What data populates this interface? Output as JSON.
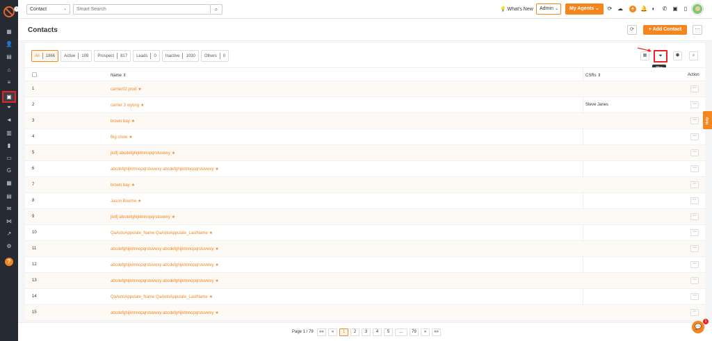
{
  "sidebar": {
    "items": [
      {
        "icon": "grid-icon",
        "glyph": "▦"
      },
      {
        "icon": "user-icon",
        "glyph": "👤"
      },
      {
        "icon": "document-icon",
        "glyph": "▤"
      },
      {
        "icon": "bank-icon",
        "glyph": "⌂"
      },
      {
        "icon": "list-icon",
        "glyph": "≡"
      },
      {
        "icon": "contacts-icon",
        "glyph": "▣",
        "active": true
      },
      {
        "icon": "funnel-icon",
        "glyph": "⏷"
      },
      {
        "icon": "megaphone-icon",
        "glyph": "◄"
      },
      {
        "icon": "file-icon",
        "glyph": "▥"
      },
      {
        "icon": "bar-chart-icon",
        "glyph": "▮"
      },
      {
        "icon": "folder-icon",
        "glyph": "▭"
      },
      {
        "icon": "google-icon",
        "glyph": "G"
      },
      {
        "icon": "calendar-icon",
        "glyph": "▦"
      },
      {
        "icon": "clipboard-icon",
        "glyph": "▤"
      },
      {
        "icon": "mail-icon",
        "glyph": "✉"
      },
      {
        "icon": "handshake-icon",
        "glyph": "⋈"
      },
      {
        "icon": "trend-icon",
        "glyph": "↗"
      },
      {
        "icon": "gear-icon",
        "glyph": "⚙"
      }
    ],
    "help_glyph": "?"
  },
  "topbar": {
    "contact_select": "Contact",
    "search_placeholder": "Smart Search",
    "whats_new": "What's New",
    "admin_select": "Admin",
    "agents_button": "My Agents"
  },
  "header": {
    "title": "Contacts",
    "add_contact": "+ Add Contact"
  },
  "filter_tabs": [
    {
      "label": "All",
      "count": "1866",
      "active": true
    },
    {
      "label": "Active",
      "count": "109"
    },
    {
      "label": "Prospect",
      "count": "817"
    },
    {
      "label": "Leads",
      "count": "0"
    },
    {
      "label": "Inactive",
      "count": "1030"
    },
    {
      "label": "Others",
      "count": "0"
    }
  ],
  "tooltip": "filter",
  "table": {
    "headers": {
      "name": "Name",
      "csrs": "CSRs",
      "action": "Action"
    },
    "rows": [
      {
        "num": "1",
        "name": "carrier02 prod",
        "csr": ""
      },
      {
        "num": "2",
        "name": "carrier 3 wyong",
        "csr": "Steve Janes"
      },
      {
        "num": "3",
        "name": "brown bay",
        "csr": ""
      },
      {
        "num": "4",
        "name": "Big show",
        "csr": ""
      },
      {
        "num": "5",
        "name": "jkdfj abcdefghijklmnopqrstuvwxy",
        "csr": ""
      },
      {
        "num": "6",
        "name": "abcdefghijklmnopqrstuvwxy abcdefghijklmnopqrstuvwxy",
        "csr": ""
      },
      {
        "num": "7",
        "name": "brown bay",
        "csr": ""
      },
      {
        "num": "8",
        "name": "Jason Bourne",
        "csr": ""
      },
      {
        "num": "9",
        "name": "jkdfj abcdefghijklmnopqrstuvwxy",
        "csr": ""
      },
      {
        "num": "10",
        "name": "QaAutoAppulate_Name QaAutoAppulate_LastName",
        "csr": ""
      },
      {
        "num": "11",
        "name": "abcdefghijklmnopqrstuvwxy abcdefghijklmnopqrstuvwxy",
        "csr": ""
      },
      {
        "num": "12",
        "name": "abcdefghijklmnopqrstuvwxy abcdefghijklmnopqrstuvwxy",
        "csr": ""
      },
      {
        "num": "13",
        "name": "abcdefghijklmnopqrstuvwxy abcdefghijklmnopqrstuvwxy",
        "csr": ""
      },
      {
        "num": "14",
        "name": "QaAutoAppulate_Name QaAutoAppulate_LastName",
        "csr": ""
      },
      {
        "num": "15",
        "name": "abcdefghijklmnopqrstuvwxy abcdefghijklmnopqrstuvwxy",
        "csr": ""
      }
    ]
  },
  "pagination": {
    "label": "Page 1 / 79",
    "buttons": [
      "««",
      "«",
      "1",
      "2",
      "3",
      "4",
      "5",
      "...",
      "79",
      "»",
      "»»"
    ],
    "active": "1"
  },
  "help_tab": "Help",
  "chat_badge": "1",
  "colors": {
    "accent": "#f5851f",
    "sidebar": "#262b33",
    "highlight": "#e22222"
  }
}
